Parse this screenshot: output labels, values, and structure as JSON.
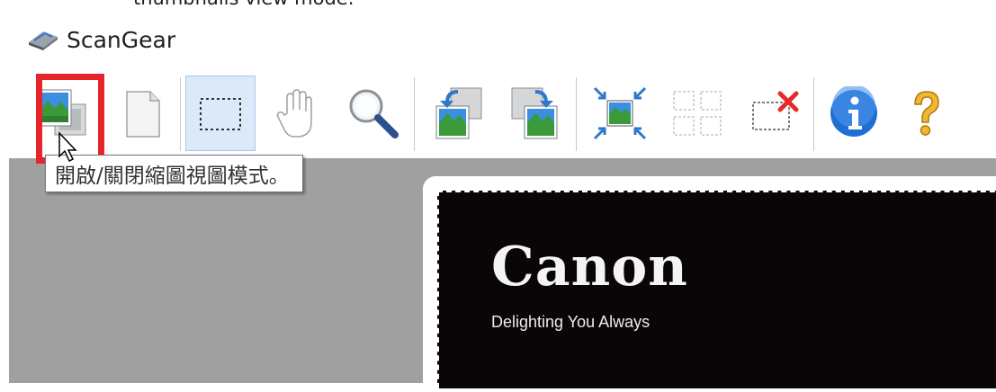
{
  "caption_fragment": "thumbnails view mode.",
  "window": {
    "title": "ScanGear"
  },
  "toolbar": {
    "buttons": [
      {
        "name": "thumbnail-toggle",
        "icon": "thumbnail-view-icon"
      },
      {
        "name": "whole-image",
        "icon": "page-icon"
      },
      {
        "name": "crop",
        "icon": "crop-frame-icon",
        "active": true
      },
      {
        "name": "move-image",
        "icon": "hand-icon"
      },
      {
        "name": "magnifier",
        "icon": "magnifier-icon"
      },
      {
        "name": "rotate-left",
        "icon": "rotate-left-icon"
      },
      {
        "name": "rotate-right",
        "icon": "rotate-right-icon"
      },
      {
        "name": "auto-crop",
        "icon": "auto-crop-icon"
      },
      {
        "name": "select-all-frames",
        "icon": "select-all-frames-icon"
      },
      {
        "name": "remove-crop-frame",
        "icon": "remove-crop-icon"
      },
      {
        "name": "information",
        "icon": "info-icon"
      },
      {
        "name": "help",
        "icon": "help-icon"
      }
    ]
  },
  "tooltip": {
    "text": "開啟/關閉縮圖視圖模式。"
  },
  "preview": {
    "brand": "Canon",
    "tagline": "Delighting You Always"
  },
  "colors": {
    "highlight": "#e8242b",
    "preview_bg": "#a0a0a0",
    "active_button": "#dbe9f8"
  }
}
